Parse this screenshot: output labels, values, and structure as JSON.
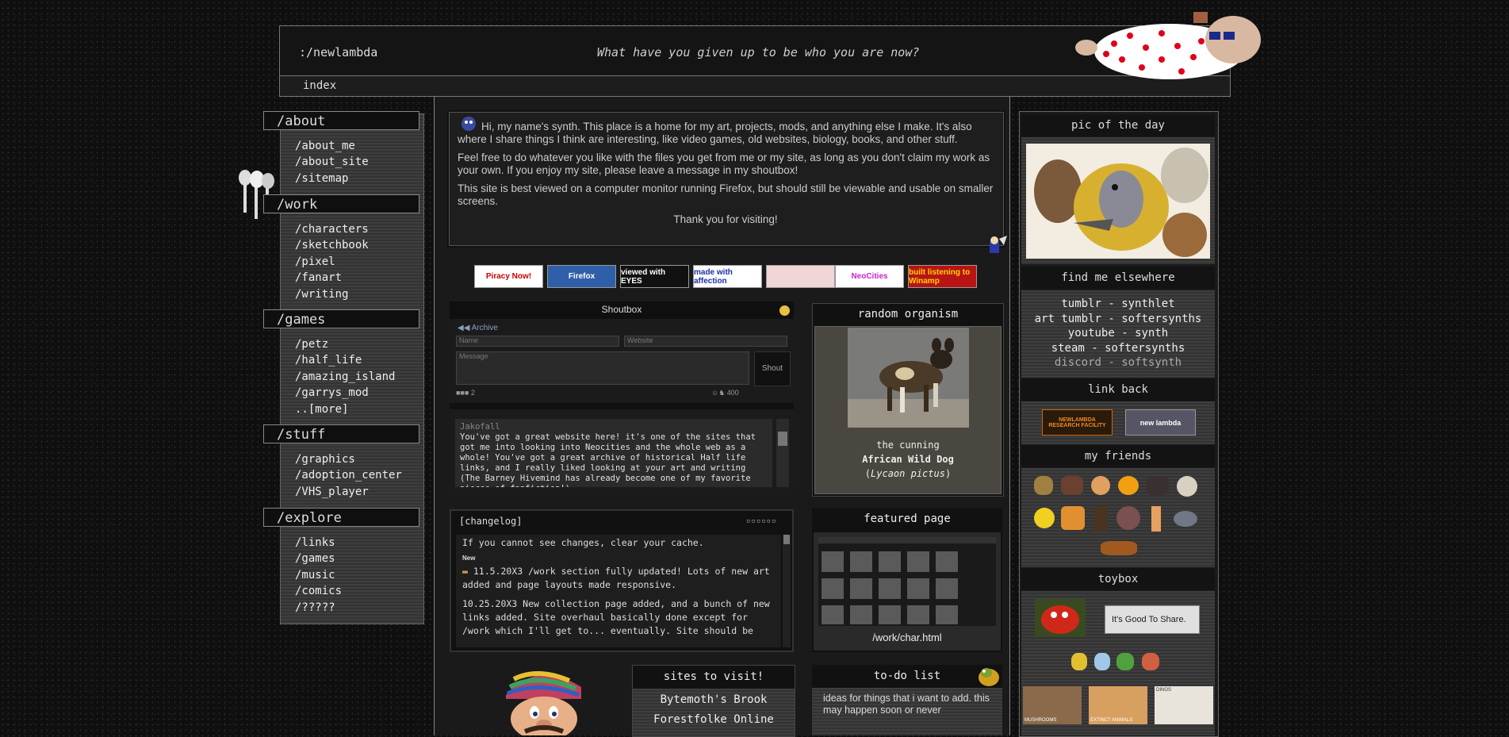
{
  "header": {
    "site_name": ":/newlambda",
    "tagline": "What have you given up to be who you are now?",
    "nav_index": "index"
  },
  "sidebar": {
    "sections": [
      {
        "title": "/about",
        "links": [
          "/about_me",
          "/about_site",
          "/sitemap"
        ]
      },
      {
        "title": "/work",
        "links": [
          "/characters",
          "/sketchbook",
          "/pixel",
          "/fanart",
          "/writing"
        ]
      },
      {
        "title": "/games",
        "links": [
          "/petz",
          "/half_life",
          "/amazing_island",
          "/garrys_mod",
          "..[more]"
        ]
      },
      {
        "title": "/stuff",
        "links": [
          "/graphics",
          "/adoption_center",
          "/VHS_player"
        ]
      },
      {
        "title": "/explore",
        "links": [
          "/links",
          "/games",
          "/music",
          "/comics",
          "/?????"
        ]
      }
    ]
  },
  "intro": {
    "p1": "Hi, my name's synth. This place is a home for my art, projects, mods, and anything else I make. It's also where I share things I think are interesting, like video games, old websites, biology, books, and other stuff.",
    "p2": "Feel free to do whatever you like with the files you get from me or my site, as long as you don't claim my work as your own. If you enjoy my site, please leave a message in my shoutbox!",
    "p3": "This site is best viewed on a computer monitor running Firefox, but should still be viewable and usable on smaller screens.",
    "p4": "Thank you for visiting!"
  },
  "badges": [
    {
      "label": "Piracy Now!",
      "bg": "#ffffff",
      "fg": "#cc0000"
    },
    {
      "label": "Firefox",
      "bg": "#2f5fa8",
      "fg": "#ffffff"
    },
    {
      "label": "viewed with EYES",
      "bg": "#111111",
      "fg": "#ffffff"
    },
    {
      "label": "made with affection",
      "bg": "#ffffff",
      "fg": "#1a2ea8"
    },
    {
      "label": "",
      "bg": "#f1d6d6",
      "fg": "#000000"
    },
    {
      "label": "NeoCities",
      "bg": "#ffffff",
      "fg": "#cc22cc"
    },
    {
      "label": "built listening to Winamp",
      "bg": "#b81414",
      "fg": "#ffd200"
    }
  ],
  "shoutbox": {
    "title": "Shoutbox",
    "archive": "Archive",
    "name_placeholder": "Name",
    "website_placeholder": "Website",
    "message_placeholder": "Message",
    "shout_button": "Shout",
    "count_left": "2",
    "count_right": "400",
    "entry_author": "Jakofall",
    "entry_text": "You've got a great website here! it's one of the sites that got me into looking into Neocities and the whole web as a whole! You've got a great archive of historical Half life links, and I really liked looking at your art and writing (The Barney Hivemind has already become one of my favorite pieces of fanfiction!)"
  },
  "changelog": {
    "title": "[changelog]",
    "notice": "If you cannot see changes, clear your cache.",
    "new_label": "New",
    "entry1": "11.5.20X3 /work section fully updated! Lots of new art added and page layouts made responsive.",
    "entry2": "10.25.20X3 New collection page added, and a bunch of new links added. Site overhaul basically done except for /work which I'll get to... eventually. Site should be"
  },
  "organism": {
    "title": "random organism",
    "line1": "the cunning",
    "name": "African Wild Dog",
    "sci_open": "(",
    "scientific": "Lycaon pictus",
    "sci_close": ")"
  },
  "featured": {
    "title": "featured page",
    "page": "/work/char.html"
  },
  "sites": {
    "title": "sites to visit!",
    "items": [
      "Bytemoth's Brook",
      "Forestfolke Online"
    ]
  },
  "todo": {
    "title": "to-do list",
    "text": "ideas for things that i want to add. this may happen soon or never"
  },
  "right": {
    "pic_title": "pic of the day",
    "elsewhere_title": "find me elsewhere",
    "elsewhere": [
      "tumblr - synthlet",
      "art tumblr - softersynths",
      "youtube - synth",
      "steam - softersynths",
      "discord - softsynth"
    ],
    "linkback_title": "link back",
    "linkback_1": "NEWLAMBDA RESEARCH FACILITY",
    "linkback_2": "new lambda",
    "friends_title": "my friends",
    "toybox_title": "toybox",
    "good_to_share": "It's Good To Share.",
    "toy_1": "MUSHROOMS",
    "toy_2": "EXTINCT ANIMALS",
    "toy_3": "DINOS"
  },
  "colors": {
    "background": "#0f0f0f",
    "panel": "#1a1a1a",
    "border": "#777777",
    "text": "#dddddd"
  }
}
